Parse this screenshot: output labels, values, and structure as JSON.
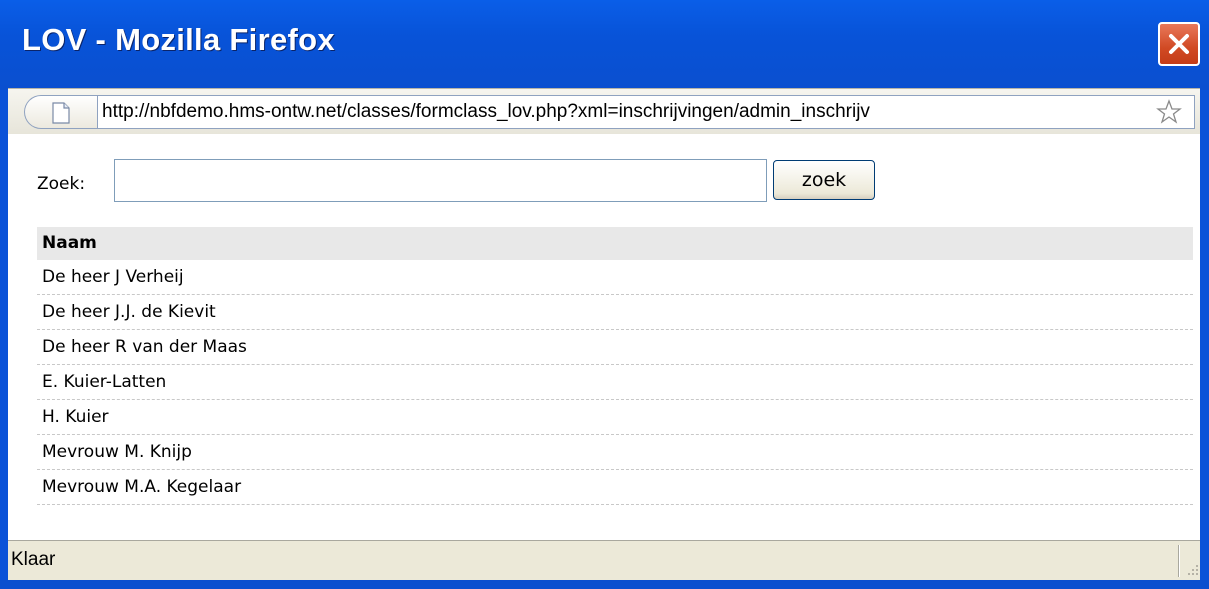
{
  "window": {
    "title": "LOV - Mozilla Firefox",
    "close_icon": "close-icon"
  },
  "addressbar": {
    "url": "http://nbfdemo.hms-ontw.net/classes/formclass_lov.php?xml=inschrijvingen/admin_inschrijv",
    "page_icon": "page-icon",
    "star_icon": "bookmark-star-icon"
  },
  "search": {
    "label": "Zoek:",
    "value": "",
    "placeholder": "",
    "button_label": "zoek"
  },
  "table": {
    "header": "Naam",
    "rows": [
      "De heer J Verheij",
      "De heer J.J. de Kievit",
      "De heer R van der Maas",
      "E. Kuier-Latten",
      "H. Kuier",
      "Mevrouw M. Knijp",
      "Mevrouw M.A. Kegelaar"
    ]
  },
  "statusbar": {
    "text": "Klaar"
  },
  "colors": {
    "titlebar": "#0a52d8",
    "close_button": "#d14a24",
    "table_header_bg": "#e8e8e8",
    "statusbar_bg": "#ece9d8"
  }
}
